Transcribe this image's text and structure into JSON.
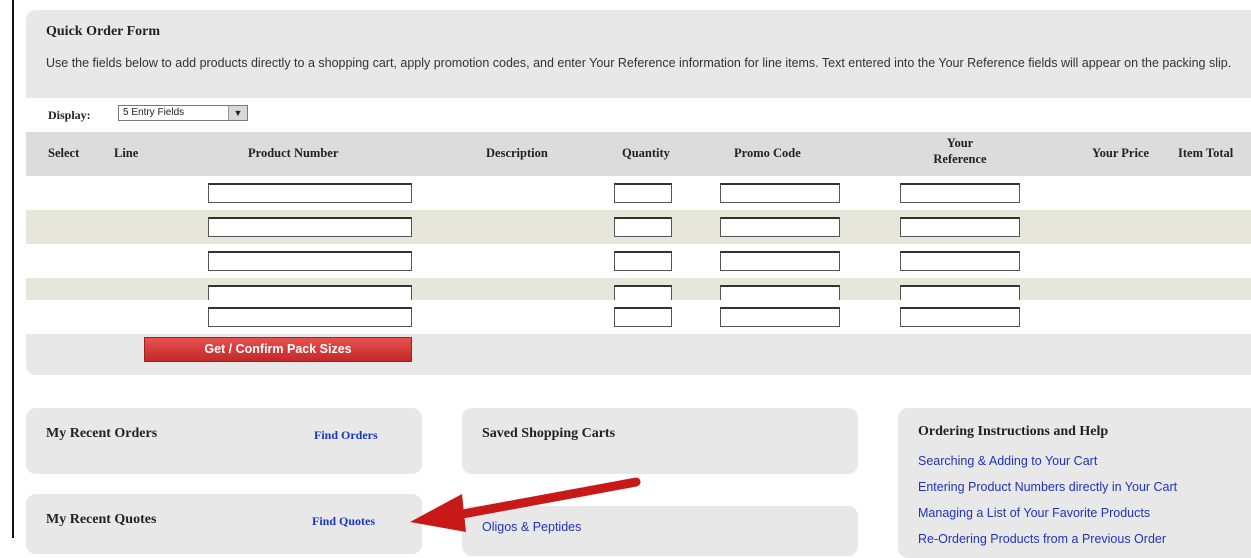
{
  "quick_order": {
    "title": "Quick Order Form",
    "description": "Use the fields below to add products directly to a shopping cart, apply promotion codes, and enter Your Reference information for line items. Text entered into the Your Reference fields will appear on the packing slip.",
    "display_label": "Display:",
    "display_value": "5 Entry Fields",
    "columns": {
      "select": "Select",
      "line": "Line",
      "product_number": "Product Number",
      "description": "Description",
      "quantity": "Quantity",
      "promo_code": "Promo Code",
      "your_reference_1": "Your",
      "your_reference_2": "Reference",
      "your_price": "Your Price",
      "item_total": "Item Total"
    },
    "rows": [
      {
        "product": "",
        "qty": "",
        "promo": "",
        "ref": ""
      },
      {
        "product": "",
        "qty": "",
        "promo": "",
        "ref": ""
      },
      {
        "product": "",
        "qty": "",
        "promo": "",
        "ref": ""
      },
      {
        "product": "",
        "qty": "",
        "promo": "",
        "ref": ""
      },
      {
        "product": "",
        "qty": "",
        "promo": "",
        "ref": ""
      }
    ],
    "pack_button": "Get / Confirm Pack Sizes"
  },
  "recent_orders": {
    "title": "My Recent Orders",
    "link": "Find Orders"
  },
  "recent_quotes": {
    "title": "My Recent Quotes",
    "link": "Find Quotes"
  },
  "saved_carts": {
    "title": "Saved Shopping Carts",
    "first_item": "Oligos & Peptides"
  },
  "help": {
    "title": "Ordering Instructions and Help",
    "links": [
      "Searching & Adding to Your Cart",
      "Entering Product Numbers directly in Your Cart",
      "Managing a List of Your Favorite Products",
      "Re-Ordering Products from a Previous Order"
    ]
  },
  "colors": {
    "link": "#1a36c0",
    "button": "#d03a3a",
    "arrow": "#c81818"
  }
}
